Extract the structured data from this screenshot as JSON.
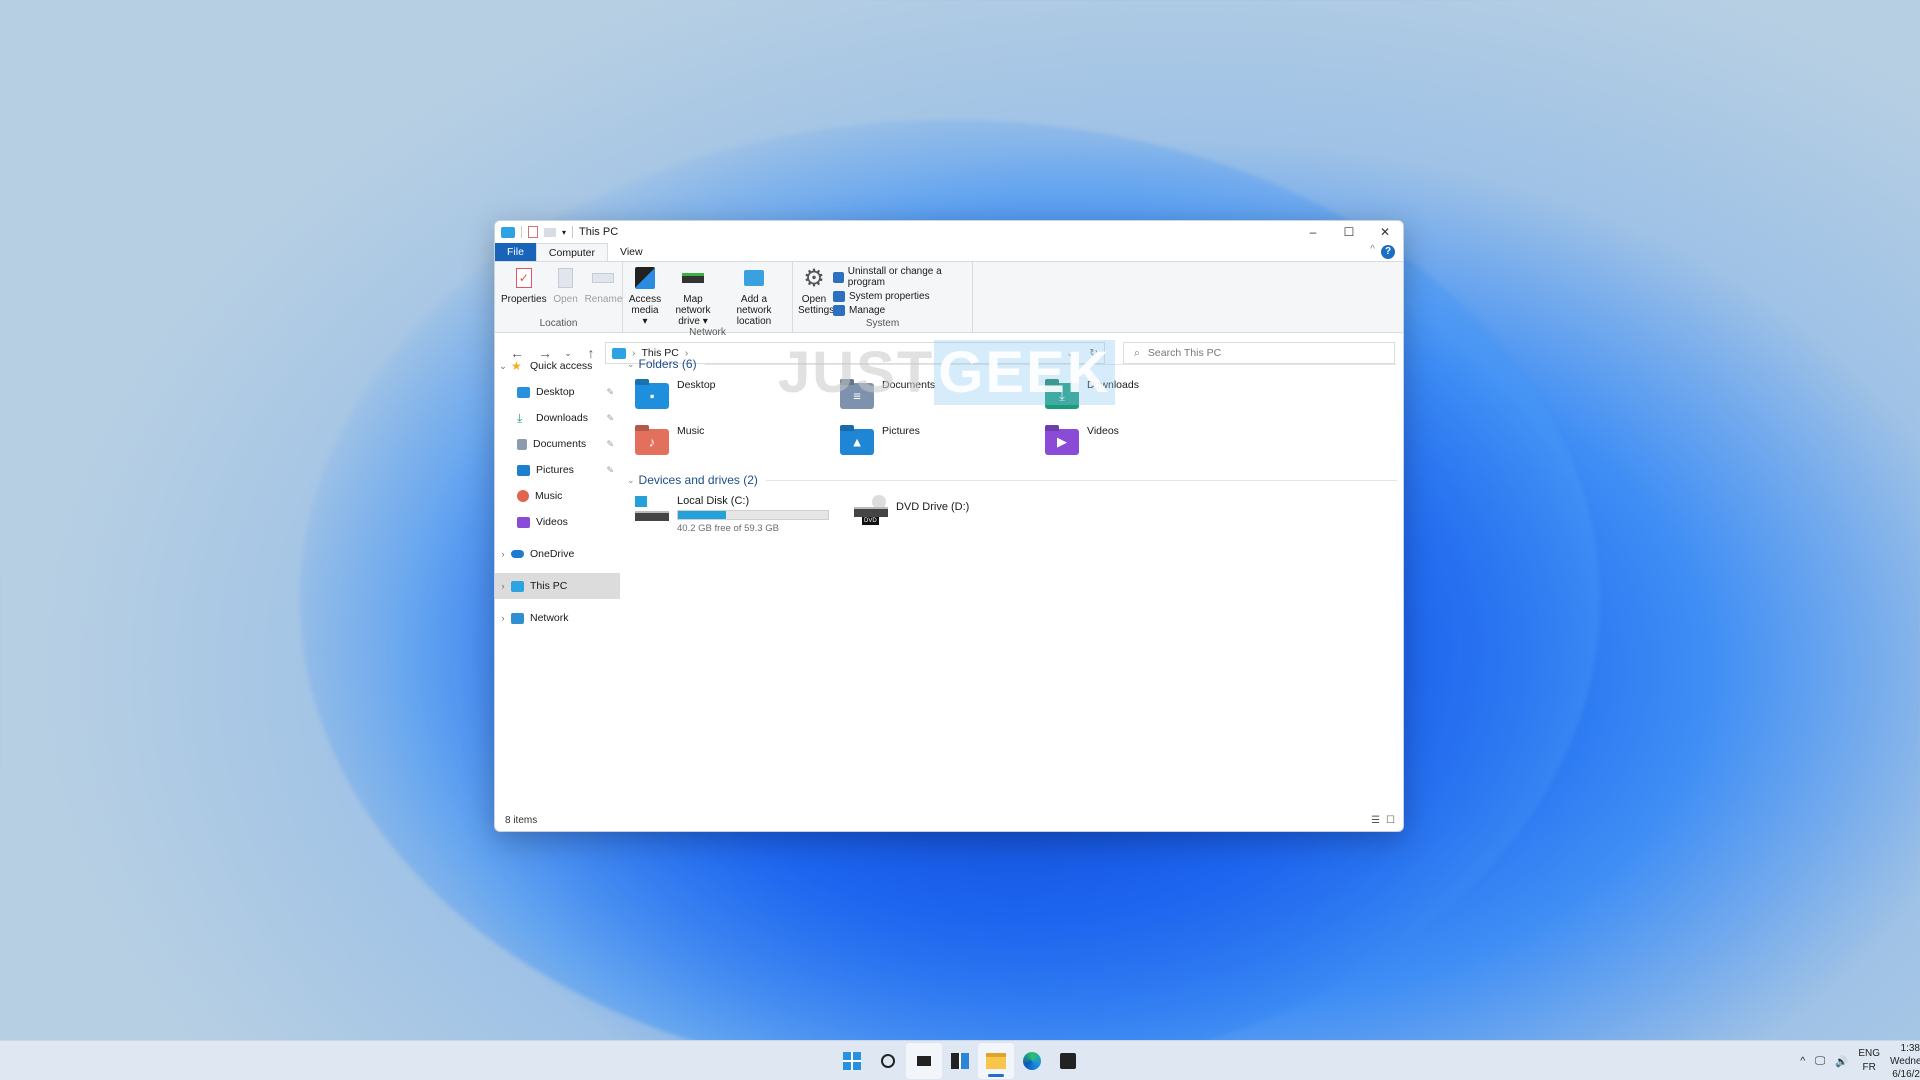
{
  "window": {
    "title": "This PC",
    "controls": {
      "minimize": "–",
      "maximize": "☐",
      "close": "✕"
    }
  },
  "ribbon": {
    "tabs": [
      {
        "label": "File"
      },
      {
        "label": "Computer"
      },
      {
        "label": "View"
      }
    ],
    "help": "?",
    "groups": [
      {
        "label": "Location",
        "buttons": [
          {
            "label": "Properties",
            "enabled": true
          },
          {
            "label": "Open",
            "enabled": false
          },
          {
            "label": "Rename",
            "enabled": false
          }
        ]
      },
      {
        "label": "Network",
        "buttons": [
          {
            "label": "Access media ▾"
          },
          {
            "label": "Map network drive ▾"
          },
          {
            "label": "Add a network location"
          }
        ]
      },
      {
        "label": "System",
        "buttons": [
          {
            "label": "Open Settings"
          }
        ],
        "small_buttons": [
          {
            "label": "Uninstall or change a program"
          },
          {
            "label": "System properties"
          },
          {
            "label": "Manage"
          }
        ]
      }
    ]
  },
  "navigation": {
    "back": "←",
    "forward": "→",
    "recent": "⌄",
    "up": "↑",
    "address": {
      "crumbs": [
        "This PC"
      ],
      "sep": "›"
    },
    "refresh": "↻",
    "search": {
      "placeholder": "Search This PC"
    }
  },
  "watermark": {
    "part1": "JUST",
    "part2": "GEEK"
  },
  "sidebar": {
    "items": [
      {
        "label": "Quick access",
        "chevron": "⌄",
        "level": 0
      },
      {
        "label": "Desktop",
        "pinned": true,
        "level": 1
      },
      {
        "label": "Downloads",
        "pinned": true,
        "level": 1
      },
      {
        "label": "Documents",
        "pinned": true,
        "level": 1
      },
      {
        "label": "Pictures",
        "pinned": true,
        "level": 1
      },
      {
        "label": "Music",
        "level": 1
      },
      {
        "label": "Videos",
        "level": 1
      },
      {
        "label": "OneDrive",
        "chevron": "›",
        "level": 0
      },
      {
        "label": "This PC",
        "chevron": "›",
        "level": 0,
        "selected": true
      },
      {
        "label": "Network",
        "chevron": "›",
        "level": 0
      }
    ],
    "pin_glyph": "📌"
  },
  "content": {
    "folders_header": "Folders (6)",
    "folders": [
      {
        "name": "Desktop",
        "color": "#1e8fdc"
      },
      {
        "name": "Documents",
        "color": "#7e92ad"
      },
      {
        "name": "Downloads",
        "color": "#1a9c7a"
      },
      {
        "name": "Music",
        "color": "#e2705c"
      },
      {
        "name": "Pictures",
        "color": "#1f86d6"
      },
      {
        "name": "Videos",
        "color": "#8a4cd6"
      }
    ],
    "drives_header": "Devices and drives (2)",
    "drives": [
      {
        "name": "Local Disk (C:)",
        "free_text": "40.2 GB free of 59.3 GB",
        "used_fraction": 0.322
      },
      {
        "name": "DVD Drive (D:)",
        "badge": "DVD"
      }
    ]
  },
  "status": {
    "items": "8 items"
  },
  "taskbar": {
    "apps": [
      "start",
      "search",
      "task-view",
      "widgets",
      "file-explorer",
      "edge",
      "store"
    ],
    "tray": {
      "lang1": "ENG",
      "lang2": "FR",
      "time": "1:38",
      "day": "Wedne",
      "date": "6/16/2"
    }
  }
}
